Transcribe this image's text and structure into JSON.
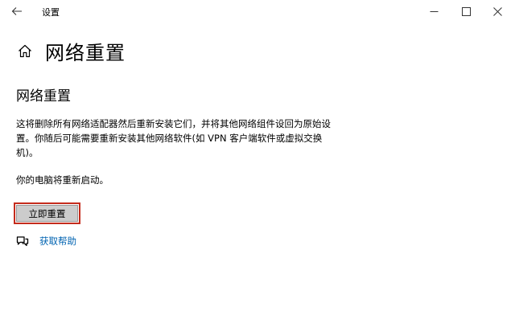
{
  "window": {
    "title": "设置",
    "controls": [
      "minimize-icon",
      "maximize-icon",
      "close-icon"
    ]
  },
  "header": {
    "home_icon": "home-icon",
    "title": "网络重置"
  },
  "section": {
    "title": "网络重置",
    "description": "这将删除所有网络适配器然后重新安装它们，并将其他网络组件设回为原始设置。你随后可能需要重新安装其他网络软件(如 VPN 客户端软件或虚拟交换机)。",
    "restart_note": "你的电脑将重新启动。",
    "reset_button": "立即重置"
  },
  "help": {
    "icon": "help-chat-icon",
    "link_text": "获取帮助"
  },
  "colors": {
    "accent_link": "#0063b1",
    "highlight_border": "#c42b1c",
    "button_bg": "#cccccc"
  }
}
